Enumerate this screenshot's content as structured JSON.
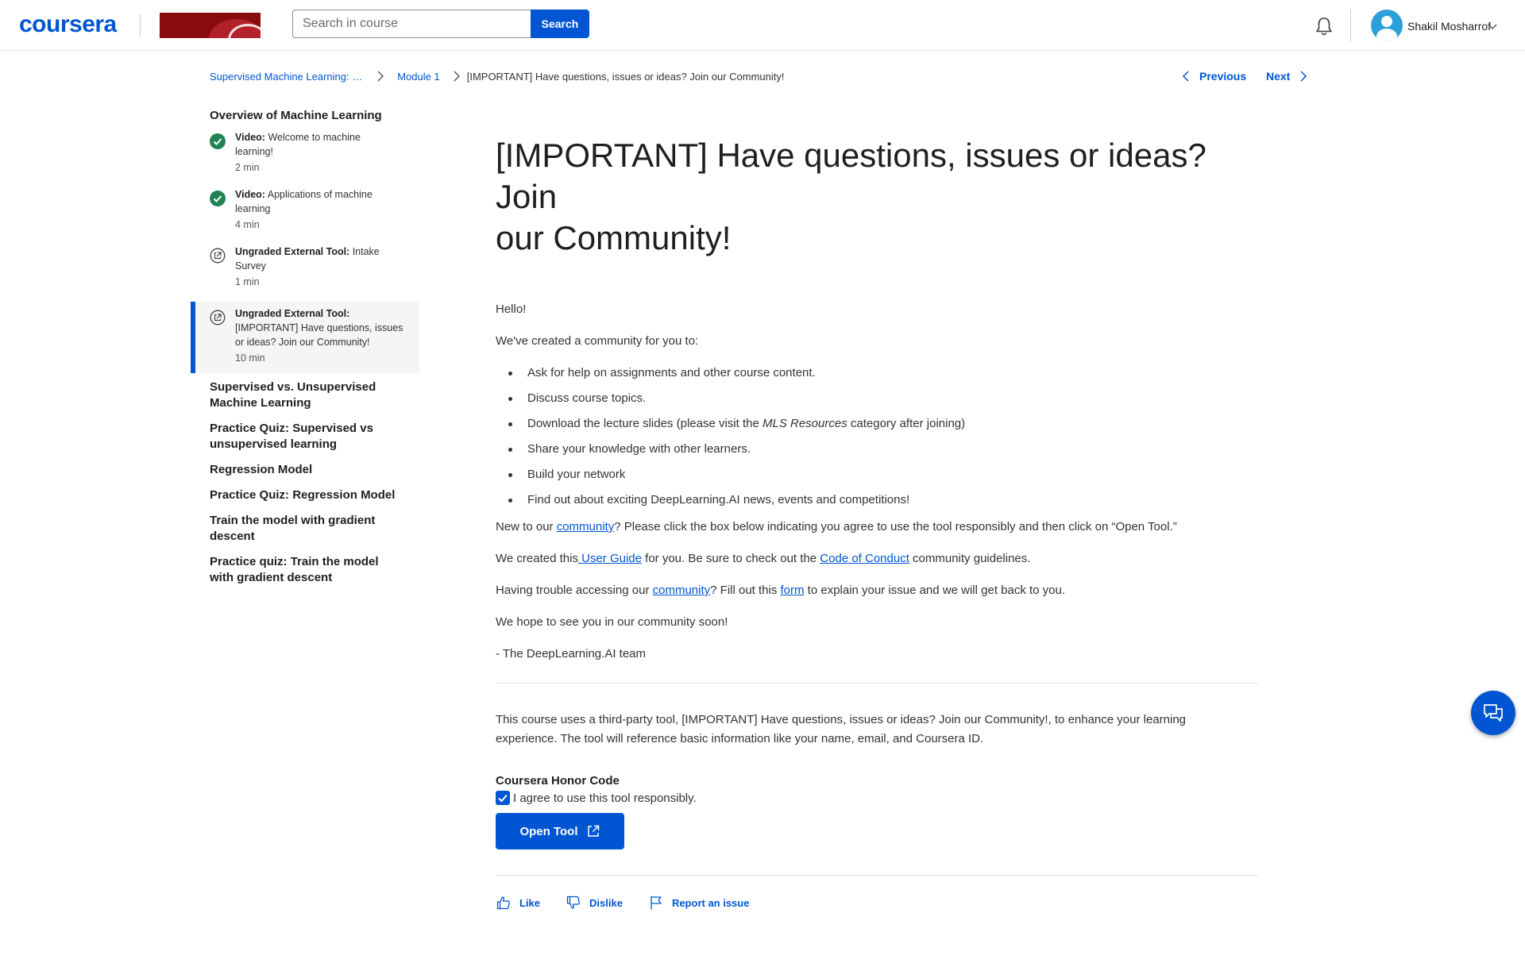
{
  "header": {
    "logo": "coursera",
    "search_placeholder": "Search in course",
    "search_button": "Search",
    "user_name": "Shakil Mosharrof"
  },
  "breadcrumb": {
    "course": "Supervised Machine Learning: …",
    "module": "Module 1",
    "current": "[IMPORTANT] Have questions, issues or ideas? Join our Community!"
  },
  "nav": {
    "previous": "Previous",
    "next": "Next"
  },
  "sidebar": {
    "section_title": "Overview of Machine Learning",
    "items": [
      {
        "kind": "Video:",
        "line1": " Welcome to machine",
        "line2": "learning!",
        "line3": "",
        "duration": "2 min",
        "status": "completed"
      },
      {
        "kind": "Video:",
        "line1": " Applications of machine",
        "line2": "learning",
        "line3": "",
        "duration": "4 min",
        "status": "completed"
      },
      {
        "kind": "Ungraded External Tool:",
        "line1": " Intake",
        "line2": "Survey",
        "line3": "",
        "duration": "1 min",
        "status": "external"
      },
      {
        "kind": "Ungraded External Tool:",
        "line1": "",
        "line2": "[IMPORTANT] Have questions, issues",
        "line3": "or ideas? Join our Community!",
        "duration": "10 min",
        "status": "external-active"
      }
    ],
    "sections": [
      {
        "l1": "Supervised vs. Unsupervised",
        "l2": "Machine Learning"
      },
      {
        "l1": "Practice Quiz: Supervised vs",
        "l2": "unsupervised learning"
      },
      {
        "l1": "Regression Model",
        "l2": ""
      },
      {
        "l1": "Practice Quiz: Regression Model",
        "l2": ""
      },
      {
        "l1": "Train the model with gradient",
        "l2": "descent"
      },
      {
        "l1": "Practice quiz: Train the model",
        "l2": "with gradient descent"
      }
    ]
  },
  "main": {
    "title_line1": "[IMPORTANT] Have questions, issues or ideas? Join",
    "title_line2": "our Community!",
    "hello": "Hello!",
    "intro": "We've created a community for you to:",
    "bullets": [
      "Ask for help on assignments and other course content.",
      "Discuss course topics.",
      "Share your knowledge with other learners.",
      "Build your network",
      "Find out about exciting DeepLearning.AI news, events and competitions!"
    ],
    "bullet_slides_pre": "Download the lecture slides (please visit the ",
    "bullet_slides_em": "MLS Resources",
    "bullet_slides_post": " category after joining)",
    "new_pre": "New to our ",
    "new_link": "community",
    "new_post": "? Please click the box below indicating you agree to use the tool responsibly and then click on “Open Tool.”",
    "guide_pre": "We created this",
    "guide_link": " User Guide",
    "guide_mid": " for you. Be sure to check out the ",
    "guide_link2": "Code of Conduct",
    "guide_post": " community guidelines.",
    "trouble_pre": "Having trouble accessing our ",
    "trouble_link": "community",
    "trouble_mid": "? Fill out this ",
    "trouble_link2": "form",
    "trouble_post": " to explain your issue and we will get back to you.",
    "hope": "We hope to see you in our community soon!",
    "signoff": "- The DeepLearning.AI team",
    "thirdparty_line1": "This course uses a third-party tool, [IMPORTANT] Have questions, issues or ideas? Join our Community!, to enhance your learning",
    "thirdparty_line2": "experience. The tool will reference basic information like your name, email, and Coursera ID.",
    "honor_title": "Coursera Honor Code",
    "agree_label": "I agree to use this tool responsibly.",
    "agree_checked": true,
    "open_tool": "Open Tool",
    "like": "Like",
    "dislike": "Dislike",
    "report": "Report an issue"
  },
  "colors": {
    "brand": "#0056d2",
    "completed": "#1f8354"
  }
}
